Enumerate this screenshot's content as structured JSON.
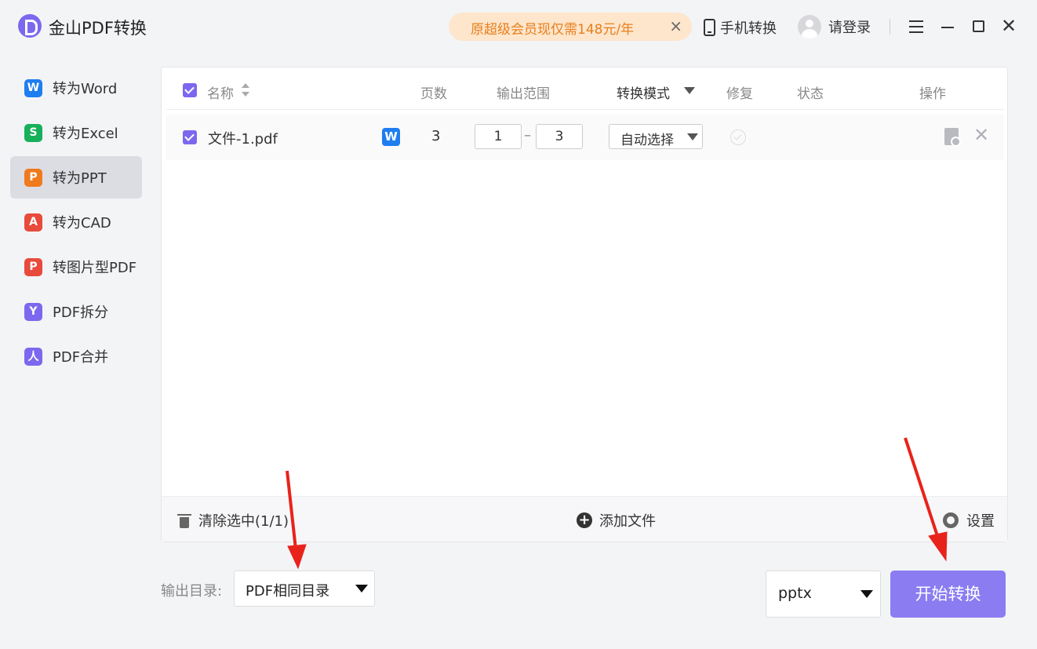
{
  "app": {
    "title": "金山PDF转换"
  },
  "promo": {
    "text": "原超级会员现仅需148元/年",
    "close": "×"
  },
  "header": {
    "mobile_convert": "手机转换",
    "login": "请登录"
  },
  "sidebar": {
    "items": [
      {
        "label": "转为Word",
        "icon": "word-icon",
        "glyph": "W",
        "color": "#1e7ef0",
        "active": false
      },
      {
        "label": "转为Excel",
        "icon": "excel-icon",
        "glyph": "S",
        "color": "#17b05a",
        "active": false
      },
      {
        "label": "转为PPT",
        "icon": "ppt-icon",
        "glyph": "P",
        "color": "#f07a1e",
        "active": true
      },
      {
        "label": "转为CAD",
        "icon": "cad-icon",
        "glyph": "A",
        "color": "#e84a3c",
        "active": false
      },
      {
        "label": "转图片型PDF",
        "icon": "image-pdf-icon",
        "glyph": "P",
        "color": "#e84a3c",
        "active": false
      },
      {
        "label": "PDF拆分",
        "icon": "split-icon",
        "glyph": "Y",
        "color": "#7b68ee",
        "active": false
      },
      {
        "label": "PDF合并",
        "icon": "merge-icon",
        "glyph": "人",
        "color": "#7b68ee",
        "active": false
      }
    ]
  },
  "table": {
    "headers": {
      "name": "名称",
      "pages": "页数",
      "range": "输出范围",
      "mode": "转换模式",
      "repair": "修复",
      "status": "状态",
      "actions": "操作"
    },
    "rows": [
      {
        "name": "文件-1.pdf",
        "pages": "3",
        "range_from": "1",
        "range_sep": "–",
        "range_to": "3",
        "mode": "自动选择"
      }
    ],
    "footer": {
      "clear": "清除选中(1/1)",
      "add": "添加文件",
      "settings": "设置"
    }
  },
  "output": {
    "label": "输出目录:",
    "dir": "PDF相同目录",
    "format": "pptx",
    "start": "开始转换"
  },
  "colors": {
    "accent": "#8b7cf2",
    "checkbox": "#7b68ee",
    "promo_bg": "#fde6cc",
    "promo_text": "#e87f1c",
    "annotation_arrow": "#e8231b"
  }
}
